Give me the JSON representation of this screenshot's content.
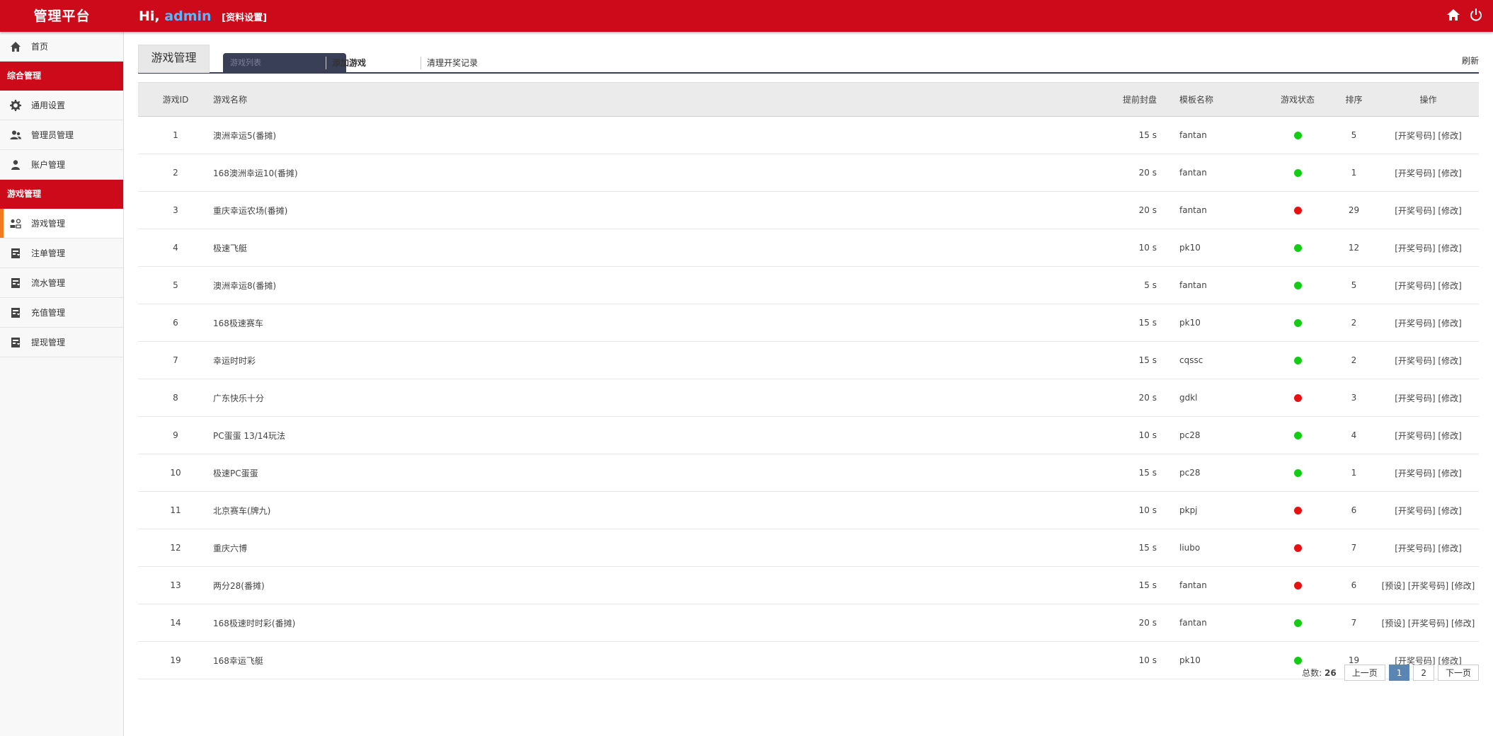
{
  "header": {
    "brand": "管理平台",
    "greeting": "Hi,",
    "username": "admin",
    "profile_link": "[资料设置]",
    "icons": [
      "home-icon",
      "power-icon"
    ]
  },
  "sidebar": {
    "home": "首页",
    "section1": "综合管理",
    "general_settings": "通用设置",
    "admin_management": "管理员管理",
    "account_management": "账户管理",
    "section2": "游戏管理",
    "game_management": "游戏管理",
    "bet_management": "注单管理",
    "flow_management": "流水管理",
    "recharge_management": "充值管理",
    "withdraw_management": "提现管理"
  },
  "tabs": {
    "current": "游戏管理",
    "list": "游戏列表",
    "add": "添加游戏",
    "clear": "清理开奖记录",
    "refresh": "刷新"
  },
  "table": {
    "headers": [
      "游戏ID",
      "游戏名称",
      "提前封盘",
      "模板名称",
      "游戏状态",
      "排序",
      "操作"
    ],
    "status_colors": {
      "on": "#15cc15",
      "off": "#e81010"
    },
    "rows": [
      {
        "id": "1",
        "name": "澳洲幸运5(番摊)",
        "adv": "15 s",
        "tpl": "fantan",
        "status": "on",
        "order": "5",
        "ops": "[开奖号码] [修改]"
      },
      {
        "id": "2",
        "name": "168澳洲幸运10(番摊)",
        "adv": "20 s",
        "tpl": "fantan",
        "status": "on",
        "order": "1",
        "ops": "[开奖号码] [修改]"
      },
      {
        "id": "3",
        "name": "重庆幸运农场(番摊)",
        "adv": "20 s",
        "tpl": "fantan",
        "status": "off",
        "order": "29",
        "ops": "[开奖号码] [修改]"
      },
      {
        "id": "4",
        "name": "极速飞艇",
        "adv": "10 s",
        "tpl": "pk10",
        "status": "on",
        "order": "12",
        "ops": "[开奖号码] [修改]"
      },
      {
        "id": "5",
        "name": "澳洲幸运8(番摊)",
        "adv": "5 s",
        "tpl": "fantan",
        "status": "on",
        "order": "5",
        "ops": "[开奖号码] [修改]"
      },
      {
        "id": "6",
        "name": "168极速赛车",
        "adv": "15 s",
        "tpl": "pk10",
        "status": "on",
        "order": "2",
        "ops": "[开奖号码] [修改]"
      },
      {
        "id": "7",
        "name": "幸运时时彩",
        "adv": "15 s",
        "tpl": "cqssc",
        "status": "on",
        "order": "2",
        "ops": "[开奖号码] [修改]"
      },
      {
        "id": "8",
        "name": "广东快乐十分",
        "adv": "20 s",
        "tpl": "gdkl",
        "status": "off",
        "order": "3",
        "ops": "[开奖号码] [修改]"
      },
      {
        "id": "9",
        "name": "PC蛋蛋 13/14玩法",
        "adv": "10 s",
        "tpl": "pc28",
        "status": "on",
        "order": "4",
        "ops": "[开奖号码] [修改]"
      },
      {
        "id": "10",
        "name": "极速PC蛋蛋",
        "adv": "15 s",
        "tpl": "pc28",
        "status": "on",
        "order": "1",
        "ops": "[开奖号码] [修改]"
      },
      {
        "id": "11",
        "name": "北京赛车(牌九)",
        "adv": "10 s",
        "tpl": "pkpj",
        "status": "off",
        "order": "6",
        "ops": "[开奖号码] [修改]"
      },
      {
        "id": "12",
        "name": "重庆六博",
        "adv": "15 s",
        "tpl": "liubo",
        "status": "off",
        "order": "7",
        "ops": "[开奖号码] [修改]"
      },
      {
        "id": "13",
        "name": "两分28(番摊)",
        "adv": "15 s",
        "tpl": "fantan",
        "status": "off",
        "order": "6",
        "ops": "[预设] [开奖号码] [修改]"
      },
      {
        "id": "14",
        "name": "168极速时时彩(番摊)",
        "adv": "20 s",
        "tpl": "fantan",
        "status": "on",
        "order": "7",
        "ops": "[预设] [开奖号码] [修改]"
      },
      {
        "id": "19",
        "name": "168幸运飞艇",
        "adv": "10 s",
        "tpl": "pk10",
        "status": "on",
        "order": "19",
        "ops": "[开奖号码] [修改]"
      }
    ]
  },
  "pager": {
    "total_label": "总数:",
    "total": "26",
    "prev": "上一页",
    "pages": [
      "1",
      "2"
    ],
    "current": "1",
    "next": "下一页"
  }
}
